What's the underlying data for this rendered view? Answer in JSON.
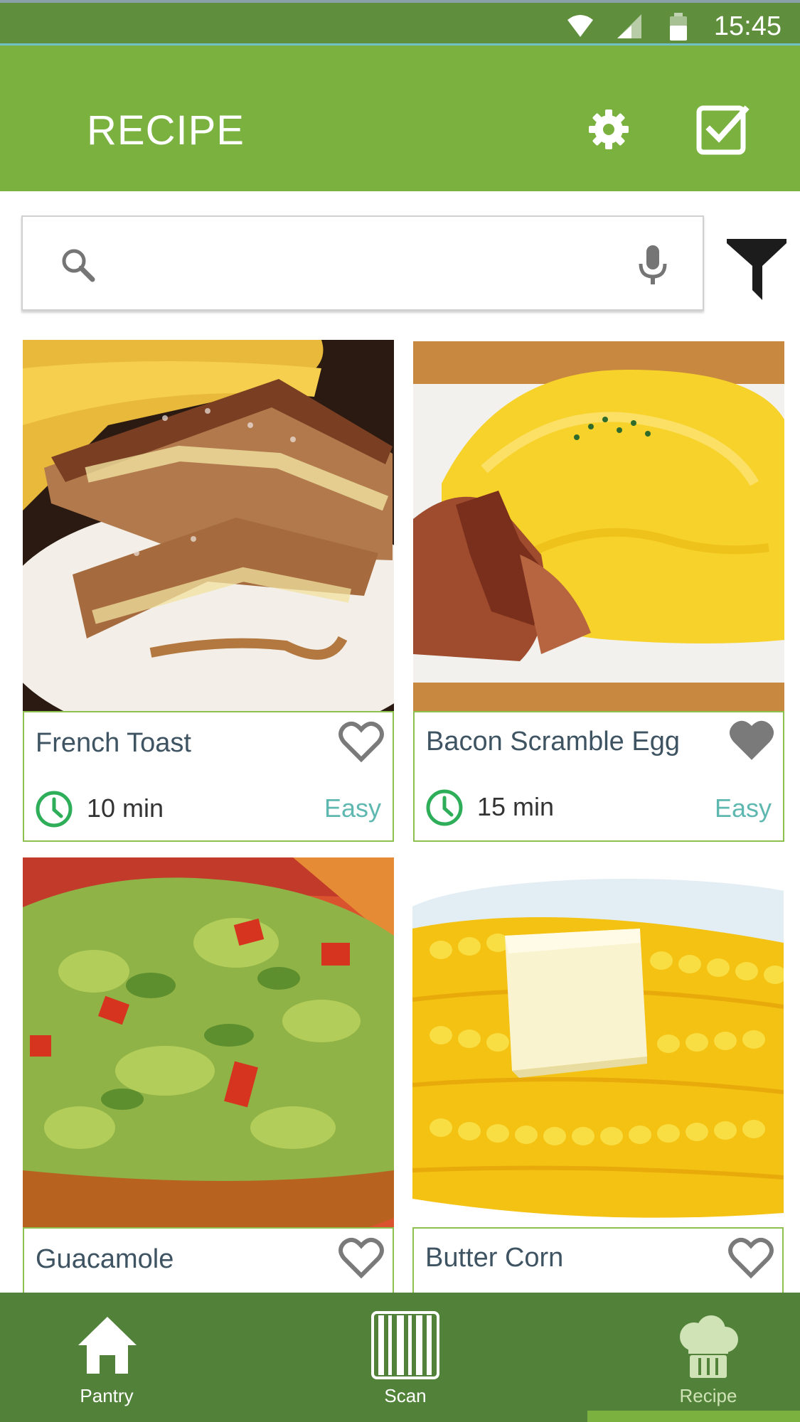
{
  "status_bar": {
    "time": "15:45"
  },
  "app_bar": {
    "title": "RECIPE",
    "settings_icon": "gear-icon",
    "select_icon": "checkbox-check-icon"
  },
  "search": {
    "placeholder": "",
    "value": ""
  },
  "colors": {
    "primary": "#7bb13f",
    "dark": "#528239",
    "accent_teal": "#5eb8b0",
    "clock_green": "#2fae5a"
  },
  "recipes": [
    {
      "name": "French Toast",
      "time": "10 min",
      "difficulty": "Easy",
      "favorited": false
    },
    {
      "name": "Bacon Scramble Egg",
      "time": "15 min",
      "difficulty": "Easy",
      "favorited": true
    },
    {
      "name": "Guacamole",
      "favorited": false
    },
    {
      "name": "Butter Corn",
      "favorited": false
    }
  ],
  "bottom_nav": {
    "items": [
      {
        "label": "Pantry",
        "icon": "house-icon"
      },
      {
        "label": "Scan",
        "icon": "barcode-icon"
      },
      {
        "label": "Recipe",
        "icon": "chef-hat-icon"
      }
    ],
    "active": "Recipe"
  }
}
